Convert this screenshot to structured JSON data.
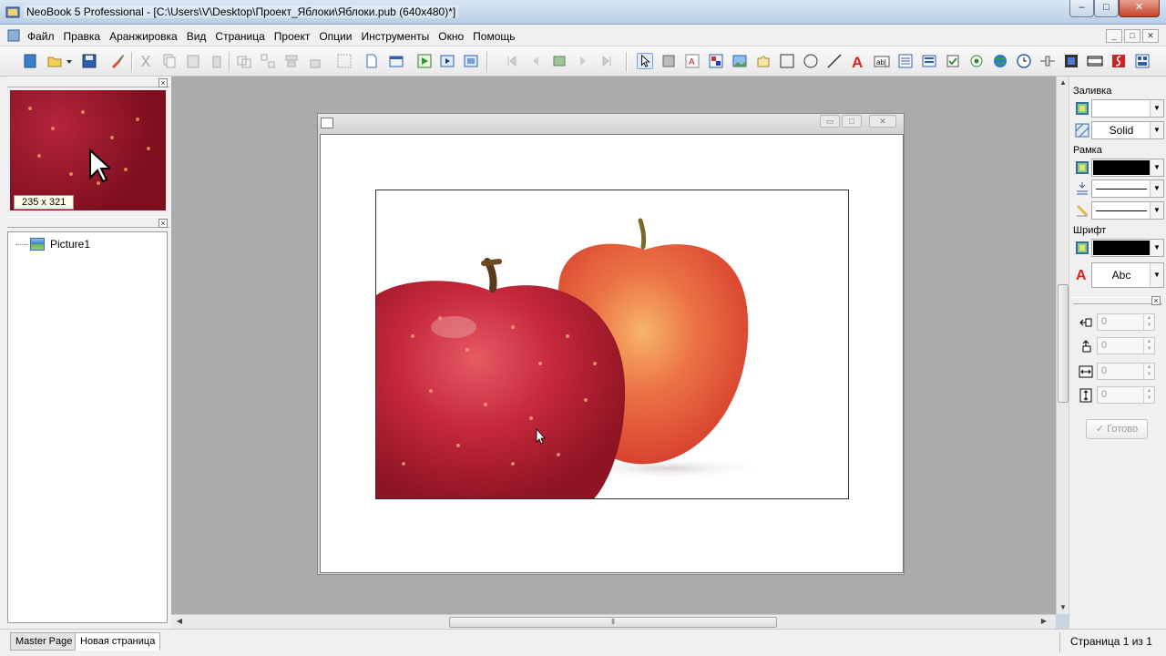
{
  "window": {
    "title": "NeoBook 5 Professional - [C:\\Users\\V\\Desktop\\Проект_Яблоки\\Яблоки.pub (640x480)*]",
    "controls": {
      "minimize": "‒",
      "maximize": "□",
      "close": "✕"
    }
  },
  "menu": {
    "items": [
      "Файл",
      "Правка",
      "Аранжировка",
      "Вид",
      "Страница",
      "Проект",
      "Опции",
      "Инструменты",
      "Окно",
      "Помощь"
    ],
    "mdi_controls": [
      "_",
      "□",
      "✕"
    ]
  },
  "left_panel": {
    "thumbnail_size": "235 x 321",
    "tree_items": [
      {
        "label": "Picture1",
        "icon": "picture-icon"
      }
    ]
  },
  "canvas": {
    "page_window_controls": [
      "▭",
      "□",
      "✕"
    ],
    "objects": [
      {
        "name": "Picture1",
        "content": "apples"
      }
    ]
  },
  "properties": {
    "fill_label": "Заливка",
    "fill_style": "Solid",
    "border_label": "Рамка",
    "font_label": "Шрифт",
    "font_sample": "Abc",
    "fields": [
      {
        "icon": "x-position-icon",
        "value": "0"
      },
      {
        "icon": "y-position-icon",
        "value": "0"
      },
      {
        "icon": "width-icon",
        "value": "0"
      },
      {
        "icon": "height-icon",
        "value": "0"
      }
    ],
    "ready_button": "✓ Готово"
  },
  "status": {
    "tabs": [
      "Master Page",
      "Новая страница"
    ],
    "page_info": "Страница 1 из 1"
  },
  "colors": {
    "titlebar": "#c7d9ee",
    "canvas_background": "#ababab",
    "close_button": "#c3452c",
    "apple_red": "#c4273a",
    "apple_orange": "#e8643c"
  }
}
